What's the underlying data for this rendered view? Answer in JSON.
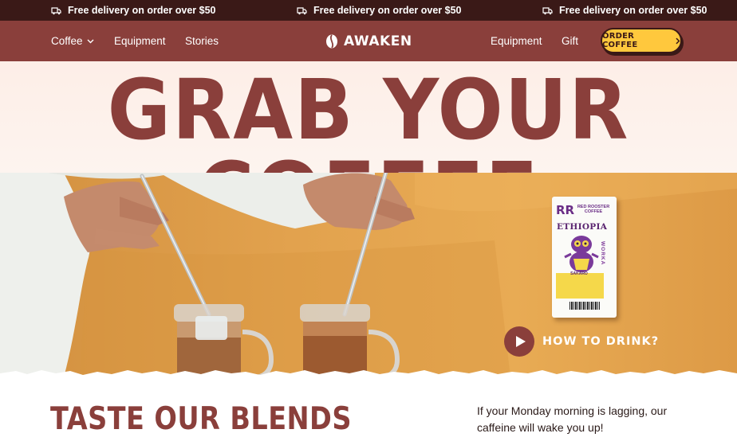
{
  "announcement": {
    "items": [
      {
        "icon": "delivery-truck-icon",
        "text": "Free delivery on order over $50"
      },
      {
        "icon": "delivery-truck-icon",
        "text": "Free delivery on order over $50"
      },
      {
        "icon": "delivery-truck-icon",
        "text": "Free delivery on order over $50"
      }
    ]
  },
  "nav": {
    "left_links": [
      {
        "label": "Coffee",
        "icon": "chevron-down-icon"
      },
      {
        "label": "Equipment"
      },
      {
        "label": "Stories"
      }
    ],
    "logo": {
      "icon": "coffee-bean-icon",
      "text": "AWAKEN"
    },
    "right_links": [
      {
        "label": "Equipment"
      },
      {
        "label": "Gift"
      }
    ],
    "cta": {
      "label": "ORDER COFFEE",
      "icon": "chevron-right-icon"
    }
  },
  "hero": {
    "title": "GRAB YOUR COFFEE",
    "bag": {
      "rr": "RR",
      "brand": "RED ROOSTER COFFEE",
      "origin": "ETHIOPIA",
      "region": "WORKA",
      "variety": "SAKARO"
    },
    "video_cta": {
      "icon": "play-icon",
      "label": "HOW TO DRINK?"
    }
  },
  "blends": {
    "title": "TASTE OUR BLENDS",
    "copy": "If your Monday morning is lagging, our caffeine will wake you  up!"
  },
  "colors": {
    "announce_bg": "#3a1917",
    "brand_red": "#8a3f3b",
    "cta_yellow": "#ffc83d",
    "hero_tint": "#fdeee7",
    "photo_orange": "#e2a24e"
  }
}
